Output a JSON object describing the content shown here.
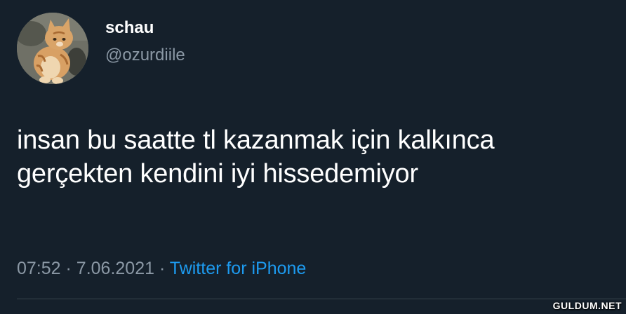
{
  "tweet": {
    "author": {
      "display_name": "schau",
      "handle": "@ozurdiile",
      "avatar_icon": "cat-avatar-icon"
    },
    "text_lines": [
      "insan bu saatte tl kazanmak için kalkınca",
      "gerçekten kendini iyi hissedemiyor"
    ],
    "meta": {
      "time": "07:52",
      "separator": "·",
      "date": "7.06.2021",
      "source": "Twitter for iPhone"
    }
  },
  "watermark": {
    "text": "GULDUM.NET"
  },
  "colors": {
    "background": "#15202b",
    "primary_text": "#ffffff",
    "secondary_text": "#8b98a5",
    "link": "#1d9bf0"
  }
}
